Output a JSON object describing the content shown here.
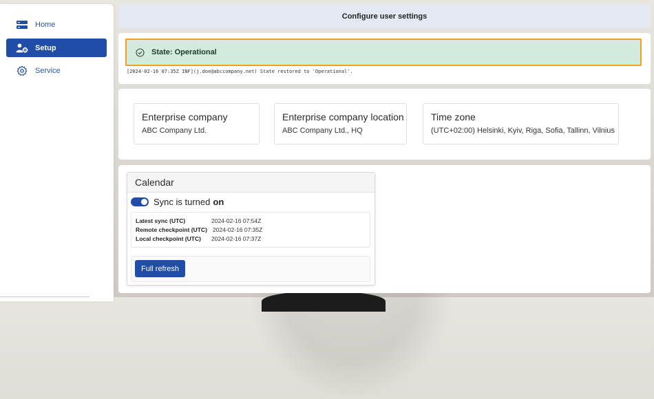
{
  "sidebar": {
    "items": [
      {
        "label": "Home",
        "icon": "home-icon",
        "active": false
      },
      {
        "label": "Setup",
        "icon": "user-settings-icon",
        "active": true
      },
      {
        "label": "Service",
        "icon": "gear-icon",
        "active": false
      }
    ]
  },
  "header": {
    "title": "Configure user settings"
  },
  "state": {
    "label": "State: Operational",
    "log": "[2024-02-16 07:35Z INF](j.doe@abccompany.net) State restored to 'Operational'."
  },
  "company": {
    "cards": [
      {
        "title": "Enterprise company",
        "value": "ABC Company Ltd."
      },
      {
        "title": "Enterprise company location",
        "value": "ABC Company Ltd., HQ"
      },
      {
        "title": "Time zone",
        "value": "(UTC+02:00) Helsinki, Kyiv, Riga, Sofia, Tallinn, Vilnius"
      }
    ]
  },
  "calendar": {
    "title": "Calendar",
    "sync_prefix": "Sync is turned",
    "sync_state": "on",
    "rows": [
      {
        "key": "Latest sync (UTC)",
        "value": "2024-02-16 07:54Z"
      },
      {
        "key": "Remote checkpoint (UTC)",
        "value": "2024-02-16 07:35Z"
      },
      {
        "key": "Local checkpoint (UTC)",
        "value": "2024-02-16 07:37Z"
      }
    ],
    "refresh_label": "Full refresh"
  },
  "colors": {
    "accent": "#1f4da8",
    "state_bg": "#d3ebdc",
    "highlight_border": "#f0a020",
    "header_bg": "#e4e8f2"
  }
}
